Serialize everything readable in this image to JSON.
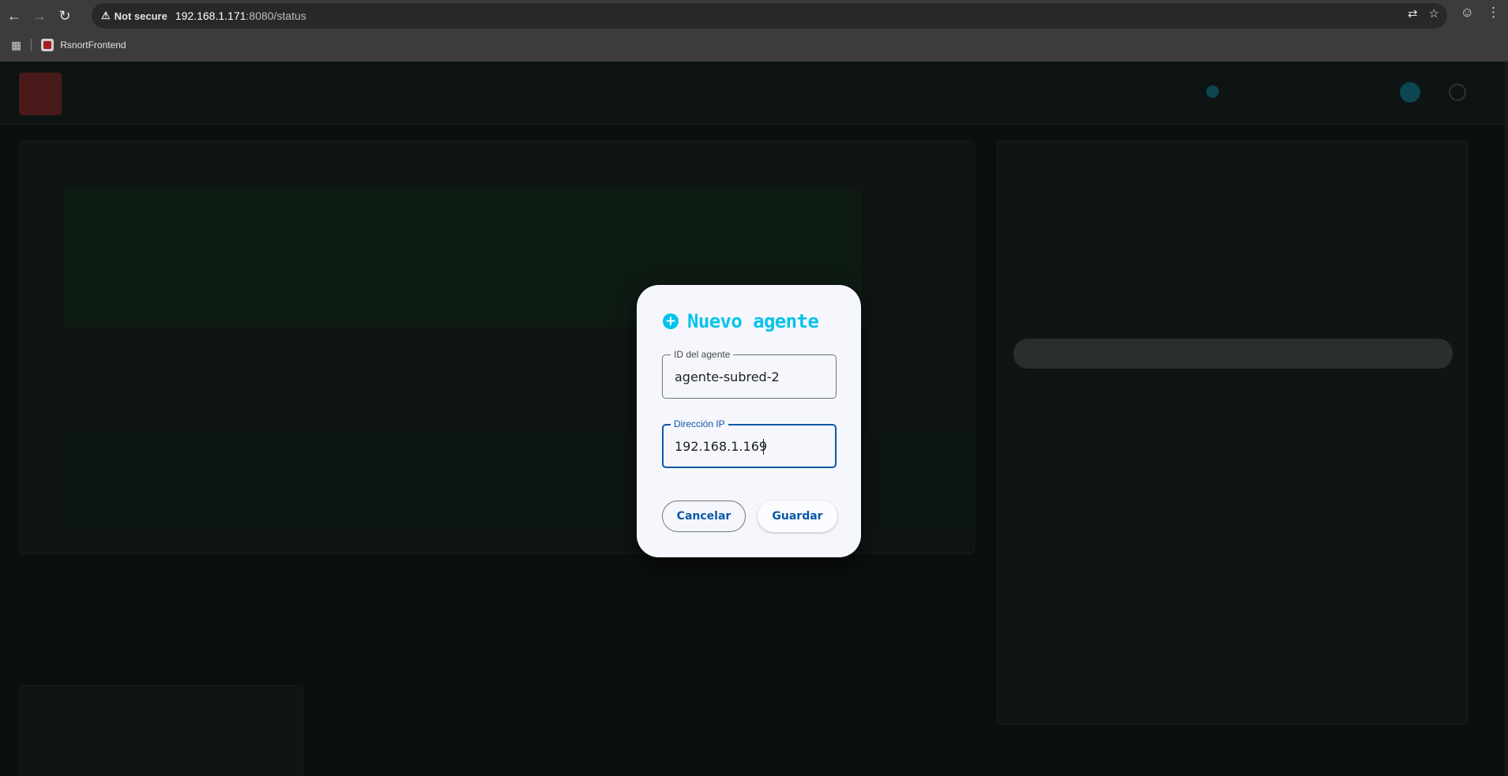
{
  "browser": {
    "security_label": "Not secure",
    "url_host": "192.168.1.171",
    "url_path": ":8080/status",
    "bookmarks": [
      {
        "label": "RsnortFrontend"
      }
    ]
  },
  "modal": {
    "title": "Nuevo agente",
    "fields": {
      "agent_id": {
        "label": "ID del agente",
        "value": "agente-subred-2"
      },
      "ip": {
        "label": "Dirección IP",
        "value": "192.168.1.169"
      }
    },
    "buttons": {
      "cancel": "Cancelar",
      "save": "Guardar"
    },
    "colors": {
      "accent": "#06c3ea",
      "primary": "#0a57a8",
      "surface": "#f6f7fc"
    }
  },
  "icons": [
    "back-arrow-icon",
    "forward-arrow-icon",
    "reload-icon",
    "warning-icon",
    "translate-icon",
    "star-icon",
    "profile-icon",
    "menu-dots-icon",
    "apps-grid-icon",
    "plus-circle-icon"
  ]
}
